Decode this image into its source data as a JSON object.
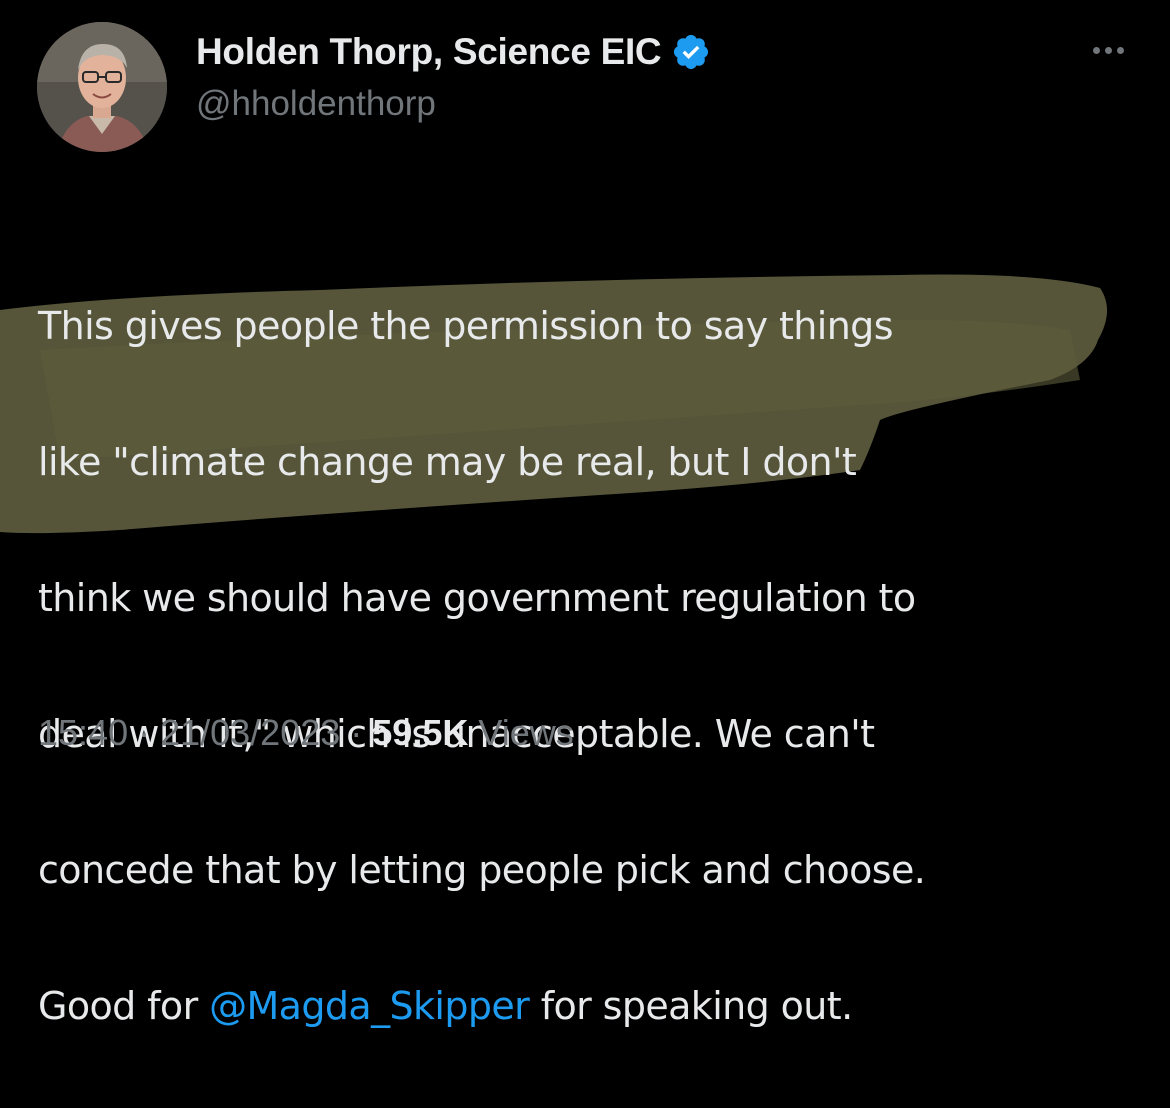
{
  "author": {
    "display_name": "Holden Thorp, Science EIC",
    "handle": "@hholdenthorp",
    "verified": true,
    "verified_icon": "verified-badge-icon",
    "avatar_description": "avatar-icon"
  },
  "more_icon": "more-horizontal-icon",
  "tweet": {
    "lines": [
      "This gives people the permission to say things",
      "like \"climate change may be real, but I don't",
      "think we should have government regulation to",
      "deal with it,\" which is unacceptable.  We can't",
      "concede that by letting people pick and choose."
    ],
    "last_line_prefix": "Good for ",
    "mention": "@Magda_Skipper",
    "last_line_suffix": " for speaking out."
  },
  "meta": {
    "time": "15:40",
    "separator": " · ",
    "date": "21/03/2023",
    "views_count": "59.5K",
    "views_label": " Views"
  },
  "colors": {
    "background": "#000000",
    "text": "#e7e9ea",
    "secondary": "#71767b",
    "accent": "#1d9bf0",
    "highlight": "#5b5a3c"
  }
}
